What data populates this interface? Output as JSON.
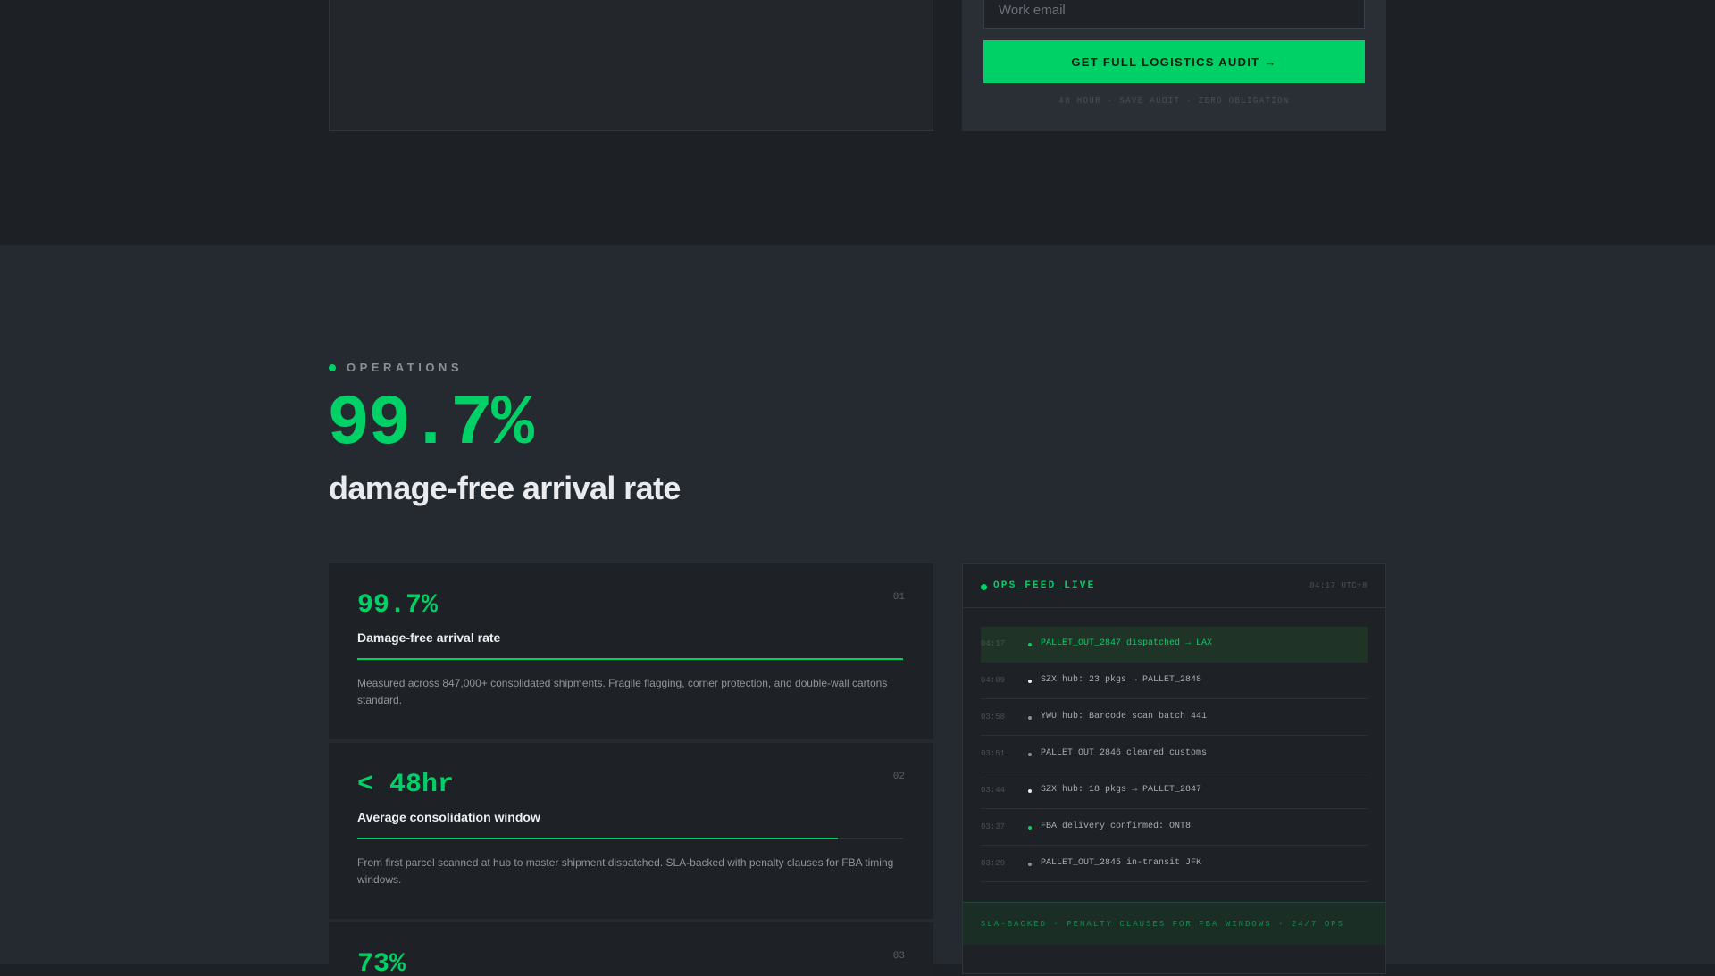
{
  "signup": {
    "email_placeholder": "Work email",
    "cta_label": "GET FULL LOGISTICS AUDIT →",
    "fine_print": "48 HOUR · SAVE AUDIT · ZERO OBLIGATION"
  },
  "operations": {
    "eyebrow": "OPERATIONS",
    "hero_value": "99.7%",
    "hero_caption": "damage-free arrival rate",
    "metrics": [
      {
        "value": "99.7%",
        "index": "01",
        "label": "Damage-free arrival rate",
        "progress": 1.0,
        "description": "Measured across 847,000+ consolidated shipments. Fragile flagging, corner protection, and double-wall cartons standard."
      },
      {
        "value": "< 48hr",
        "index": "02",
        "label": "Average consolidation window",
        "progress": 0.88,
        "description": "From first parcel scanned at hub to master shipment dispatched. SLA-backed with penalty clauses for FBA timing windows."
      },
      {
        "value": "73%",
        "index": "03",
        "label": "",
        "progress": 0.73,
        "description": ""
      }
    ]
  },
  "feed": {
    "title": "OPS_FEED_LIVE",
    "clock": "04:17 UTC+8",
    "rows": [
      {
        "time": "04:17",
        "text": "PALLET_OUT_2847 dispatched → LAX",
        "bullet_color": "#00d167",
        "active": true
      },
      {
        "time": "04:09",
        "text": "SZX hub: 23 pkgs → PALLET_2848",
        "bullet_color": "#e8eaed",
        "active": false
      },
      {
        "time": "03:58",
        "text": "YWU hub: Barcode scan batch 441",
        "bullet_color": "#8a9099",
        "active": false
      },
      {
        "time": "03:51",
        "text": "PALLET_OUT_2846 cleared customs",
        "bullet_color": "#8a9099",
        "active": false
      },
      {
        "time": "03:44",
        "text": "SZX hub: 18 pkgs → PALLET_2847",
        "bullet_color": "#e8eaed",
        "active": false
      },
      {
        "time": "03:37",
        "text": "FBA delivery confirmed: ONT8",
        "bullet_color": "#00d167",
        "active": false
      },
      {
        "time": "03:29",
        "text": "PALLET_OUT_2845 in-transit JFK",
        "bullet_color": "#8a9099",
        "active": false
      }
    ],
    "footer": "SLA-BACKED · PENALTY CLAUSES FOR FBA WINDOWS · 24/7 OPS"
  }
}
